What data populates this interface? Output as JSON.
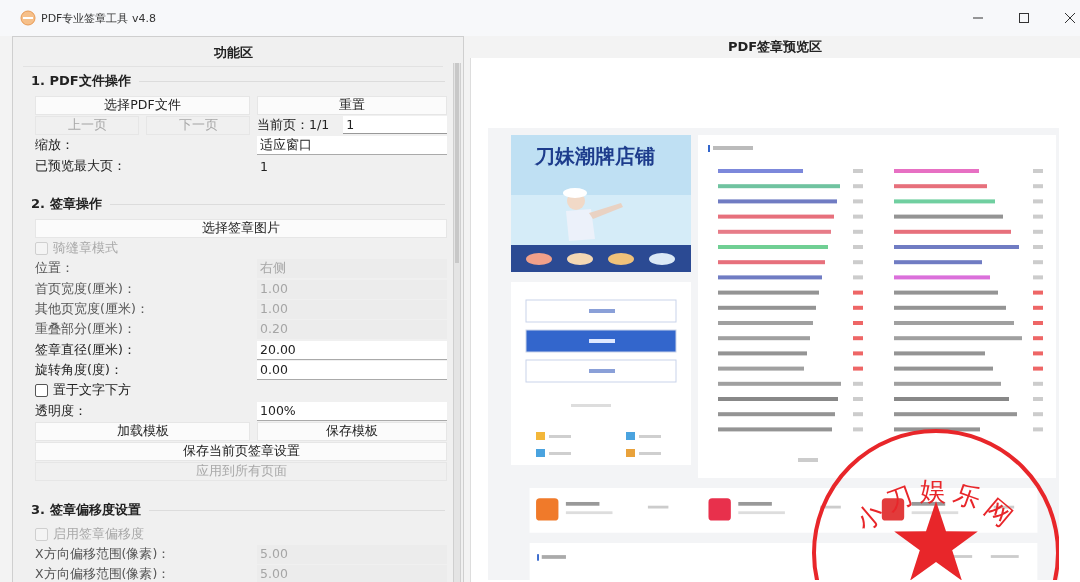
{
  "window": {
    "title": "PDF专业签章工具 v4.8"
  },
  "left_panel": {
    "title": "功能区",
    "sections": [
      {
        "title": "1. PDF文件操作",
        "items": [
          {
            "kind": "buttons",
            "buttons": [
              {
                "label": "选择PDF文件",
                "disabled": false
              },
              {
                "label": "重置",
                "disabled": false
              }
            ]
          },
          {
            "kind": "pager",
            "buttons": [
              {
                "label": "上一页",
                "disabled": true
              },
              {
                "label": "下一页",
                "disabled": true
              }
            ],
            "label": "当前页：1/1",
            "value": "1"
          },
          {
            "kind": "field",
            "label": "缩放：",
            "value": "适应窗口",
            "disabled": false
          },
          {
            "kind": "text",
            "label": "已预览最大页：",
            "value": "1"
          }
        ]
      },
      {
        "title": "2. 签章操作",
        "items": [
          {
            "kind": "buttons",
            "buttons": [
              {
                "label": "选择签章图片",
                "disabled": false
              }
            ]
          },
          {
            "kind": "checkbox",
            "label": "骑缝章模式",
            "checked": false,
            "disabled": true
          },
          {
            "kind": "field",
            "label": "位置：",
            "value": "右侧",
            "disabled": true
          },
          {
            "kind": "field",
            "label": "首页宽度(厘米)：",
            "value": "1.00",
            "disabled": true
          },
          {
            "kind": "field",
            "label": "其他页宽度(厘米)：",
            "value": "1.00",
            "disabled": true
          },
          {
            "kind": "field",
            "label": "重叠部分(厘米)：",
            "value": "0.20",
            "disabled": true
          },
          {
            "kind": "field",
            "label": "签章直径(厘米)：",
            "value": "20.00",
            "disabled": false
          },
          {
            "kind": "field",
            "label": "旋转角度(度)：",
            "value": "0.00",
            "disabled": false
          },
          {
            "kind": "checkbox",
            "label": "置于文字下方",
            "checked": false,
            "disabled": false
          },
          {
            "kind": "field",
            "label": "透明度：",
            "value": "100%",
            "disabled": false
          },
          {
            "kind": "buttons",
            "buttons": [
              {
                "label": "加载模板",
                "disabled": false
              },
              {
                "label": "保存模板",
                "disabled": false
              }
            ]
          },
          {
            "kind": "buttons",
            "buttons": [
              {
                "label": "保存当前页签章设置",
                "disabled": false
              }
            ]
          },
          {
            "kind": "buttons",
            "buttons": [
              {
                "label": "应用到所有页面",
                "disabled": true
              }
            ]
          }
        ]
      },
      {
        "title": "3. 签章偏移度设置",
        "items": [
          {
            "kind": "checkbox",
            "label": "启用签章偏移度",
            "checked": false,
            "disabled": true
          },
          {
            "kind": "field",
            "label": "X方向偏移范围(像素)：",
            "value": "5.00",
            "disabled": true
          },
          {
            "kind": "field",
            "label": "X方向偏移范围(像素)：",
            "value": "5.00",
            "disabled": true
          }
        ]
      }
    ]
  },
  "preview": {
    "title": "PDF签章预览区",
    "page": {
      "banner_title": "刀妹潮牌店铺",
      "stamp_text": "小刀娱乐网"
    }
  }
}
